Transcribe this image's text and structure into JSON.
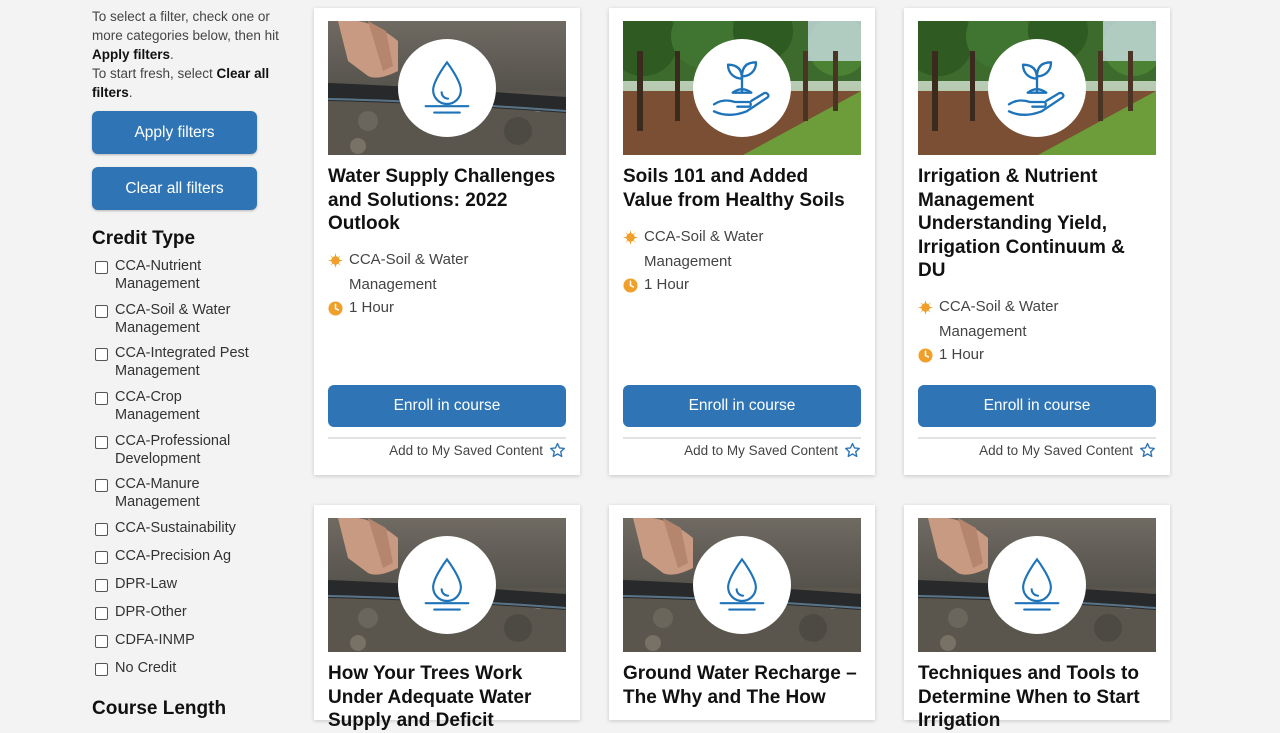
{
  "sidebar": {
    "intro": {
      "line1": "To select a filter, check one or more categories below, then hit ",
      "apply_bold": "Apply filters",
      "period1": ".",
      "line2": "To start fresh, select ",
      "clear_bold": "Clear all filters",
      "period2": "."
    },
    "apply_label": "Apply filters",
    "clear_label": "Clear all filters",
    "credit_type_title": "Credit Type",
    "credit_types": [
      "CCA-Nutrient Management",
      "CCA-Soil & Water Management",
      "CCA-Integrated Pest Management",
      "CCA-Crop Management",
      "CCA-Professional Development",
      "CCA-Manure Management",
      "CCA-Sustainability",
      "CCA-Precision Ag",
      "DPR-Law",
      "DPR-Other",
      "CDFA-INMP",
      "No Credit"
    ],
    "course_length_title": "Course Length"
  },
  "courses": [
    {
      "title": "Water Supply Challenges and Solutions: 2022 Outlook",
      "credit": "CCA-Soil & Water Management",
      "duration": "1 Hour",
      "image": "hand-pipe-photo",
      "icon": "water-drop-icon"
    },
    {
      "title": "Soils 101 and Added Value from Healthy Soils",
      "credit": "CCA-Soil & Water Management",
      "duration": "1 Hour",
      "image": "orchard-photo",
      "icon": "sprout-hand-icon"
    },
    {
      "title": "Irrigation & Nutrient Management Understanding Yield, Irrigation Continuum & DU",
      "credit": "CCA-Soil & Water Management",
      "duration": "1 Hour",
      "image": "orchard-photo",
      "icon": "sprout-hand-icon"
    },
    {
      "title": "How Your Trees Work Under Adequate Water Supply and Deficit",
      "image": "hand-pipe-photo",
      "icon": "water-drop-icon"
    },
    {
      "title": "Ground Water Recharge – The Why and The How",
      "image": "hand-pipe-photo",
      "icon": "water-drop-icon"
    },
    {
      "title": "Techniques and Tools to Determine When to Start Irrigation",
      "image": "hand-pipe-photo",
      "icon": "water-drop-icon"
    }
  ],
  "card_labels": {
    "enroll": "Enroll in course",
    "save": "Add to My Saved Content"
  },
  "colors": {
    "primary": "#2f75b5",
    "icon_blue": "#1e73b9",
    "accent_orange": "#f0a02a",
    "background": "#f3f3f3"
  }
}
